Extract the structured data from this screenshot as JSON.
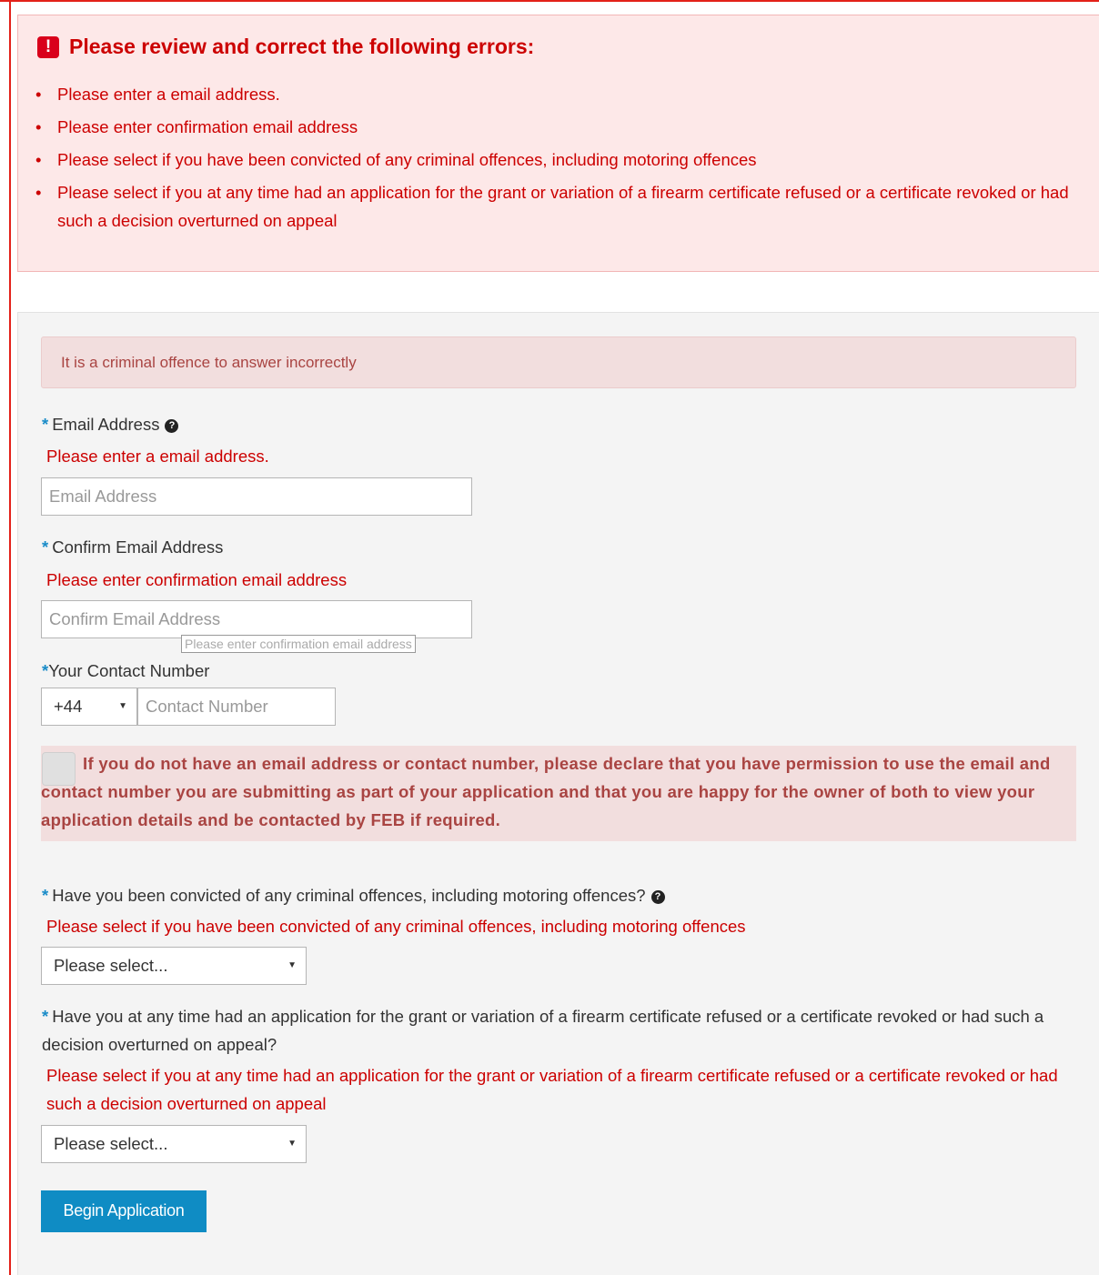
{
  "error_summary": {
    "title": "Please review and correct the following errors:",
    "icon": "exclamation-alert-icon",
    "items": [
      "Please enter a email address.",
      "Please enter confirmation email address",
      "Please select if you have been convicted of any criminal offences, including motoring offences",
      "Please select if you at any time had an application for the grant or variation of a firearm certificate refused or a certificate revoked or had such a decision overturned on appeal"
    ]
  },
  "notice": "It is a criminal offence to answer incorrectly",
  "email": {
    "required_mark": "*",
    "label": "Email Address",
    "error": "Please enter a email address.",
    "placeholder": "Email Address",
    "value": ""
  },
  "confirm_email": {
    "required_mark": "*",
    "label": "Confirm Email Address",
    "error": "Please enter confirmation email address",
    "placeholder": "Confirm Email Address",
    "value": "",
    "tooltip": "Please enter confirmation email address"
  },
  "contact": {
    "required_mark": "*",
    "label": "Your Contact Number",
    "country_code": "+44",
    "placeholder": "Contact Number",
    "value": ""
  },
  "declaration": {
    "checked": false,
    "text": "If you do not have an email address or contact number, please declare that you have permission to use the email and contact number you are submitting as part of your application and that you are happy for the owner of both to view your application details and be contacted by FEB if required."
  },
  "q_convicted": {
    "required_mark": "*",
    "label": "Have you been convicted of any criminal offences, including motoring offences?",
    "error": "Please select if you have been convicted of any criminal offences, including motoring offences",
    "selected": "Please select..."
  },
  "q_refused": {
    "required_mark": "*",
    "label": "Have you at any time had an application for the grant or variation of a firearm certificate refused or a certificate revoked or had such a decision overturned on appeal?",
    "error": "Please select if you at any time had an application for the grant or variation of a firearm certificate refused or a certificate revoked or had such a decision overturned on appeal",
    "selected": "Please select..."
  },
  "submit_label": "Begin Application",
  "colors": {
    "error_red": "#cc0000",
    "frame_red": "#e32119",
    "required_star": "#1a8cc8",
    "button_blue": "#0f8cc4",
    "alert_background": "#f2dede"
  }
}
